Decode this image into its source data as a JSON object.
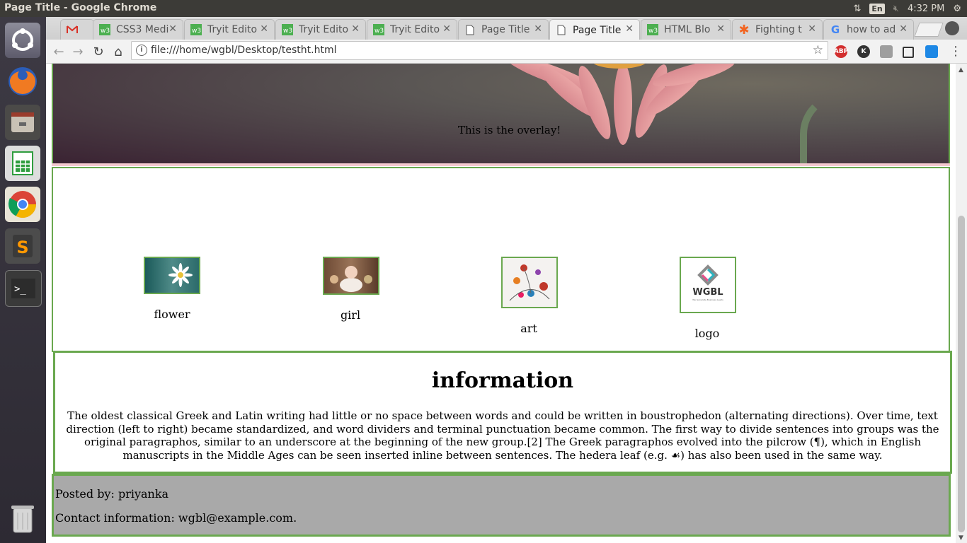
{
  "window": {
    "title": "Page Title - Google Chrome"
  },
  "tray": {
    "lang": "En",
    "time": "4:32 PM"
  },
  "tabs": [
    {
      "label": "",
      "icon": "gmail-icon",
      "active": false
    },
    {
      "label": "CSS3 Medi",
      "icon": "w3schools-icon",
      "active": false
    },
    {
      "label": "Tryit Edito",
      "icon": "w3schools-icon",
      "active": false
    },
    {
      "label": "Tryit Edito",
      "icon": "w3schools-icon",
      "active": false
    },
    {
      "label": "Tryit Edito",
      "icon": "w3schools-icon",
      "active": false
    },
    {
      "label": "Page Title",
      "icon": "page-icon",
      "active": false
    },
    {
      "label": "Page Title",
      "icon": "page-icon",
      "active": true
    },
    {
      "label": "HTML Blo",
      "icon": "w3schools-icon",
      "active": false
    },
    {
      "label": "Fighting t",
      "icon": "asterisk-icon",
      "active": false
    },
    {
      "label": "how to ad",
      "icon": "google-icon",
      "active": false
    }
  ],
  "address": {
    "url": "file:///home/wgbl/Desktop/testht.html"
  },
  "extensions": [
    "ABP",
    "K",
    "",
    "",
    ""
  ],
  "page": {
    "hero": {
      "overlay_text": "This is the overlay!"
    },
    "gallery": [
      {
        "caption": "flower"
      },
      {
        "caption": "girl"
      },
      {
        "caption": "art"
      },
      {
        "caption": "logo",
        "logo_text": "WGBL",
        "logo_sub": "We Generate Business Leads"
      }
    ],
    "info": {
      "heading": "information",
      "body": "The oldest classical Greek and Latin writing had little or no space between words and could be written in boustrophedon (alternating directions). Over time, text direction (left to right) became standardized, and word dividers and terminal punctuation became common. The first way to divide sentences into groups was the original paragraphos, similar to an underscore at the beginning of the new group.[2] The Greek paragraphos evolved into the pilcrow (¶), which in English manuscripts in the Middle Ages can be seen inserted inline between sentences. The hedera leaf (e.g. ☙) has also been used in the same way."
    },
    "footer": {
      "posted_by": "Posted by: priyanka",
      "contact": "Contact information: wgbl@example.com."
    }
  },
  "colors": {
    "border_green": "#6aa84f",
    "footer_gray": "#a9a9a9"
  }
}
